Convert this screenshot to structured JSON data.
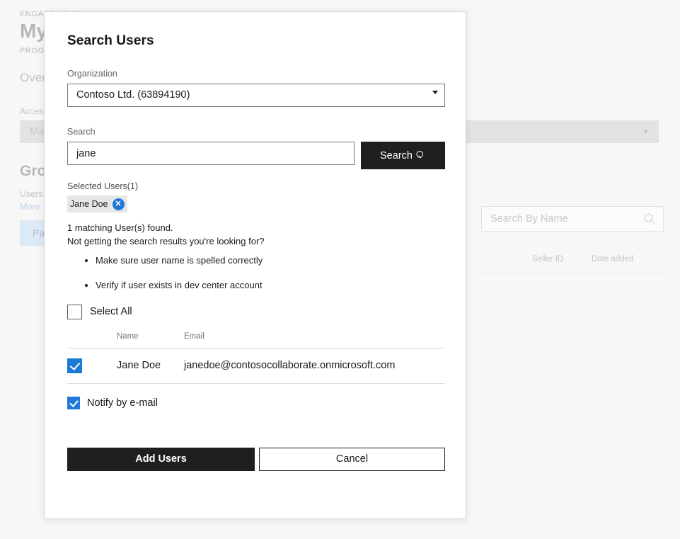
{
  "background": {
    "eyebrow": "ENGAGEMENT",
    "title": "My",
    "eyebrow2": "PROGRAM",
    "tab": "Overview",
    "access_label": "Access level",
    "access_value": "Manage",
    "section_title": "Groups",
    "paragraph": "Users below associ",
    "more_link": "More",
    "pill": "Partners",
    "search_placeholder": "Search By Name",
    "search_icon": "search-icon",
    "columns": [
      "Seller ID",
      "Date added"
    ],
    "caret_icon": "chevron-down-icon"
  },
  "modal": {
    "title": "Search Users",
    "organization": {
      "label": "Organization",
      "value": "Contoso Ltd. (63894190)",
      "caret_icon": "chevron-down-icon"
    },
    "search": {
      "label": "Search",
      "value": "jane",
      "placeholder": "",
      "button_label": "Search",
      "button_icon": "search-icon"
    },
    "selected_users": {
      "label": "Selected Users(1)",
      "chips": [
        {
          "name": "Jane Doe",
          "remove_icon": "close-circle-icon"
        }
      ]
    },
    "results": {
      "found_text": "1 matching User(s) found.",
      "prompt_text": "Not getting the search results you're looking for?",
      "tips": [
        "Make sure user name is spelled correctly",
        "Verify if user exists in dev center account"
      ]
    },
    "select_all": {
      "label": "Select All",
      "checked": false
    },
    "table": {
      "columns": [
        "Name",
        "Email"
      ],
      "rows": [
        {
          "checked": true,
          "name": "Jane Doe",
          "email": "janedoe@contosocollaborate.onmicrosoft.com"
        }
      ]
    },
    "notify": {
      "label": "Notify by e-mail",
      "checked": true
    },
    "footer": {
      "primary_label": "Add Users",
      "secondary_label": "Cancel"
    }
  },
  "colors": {
    "accent_blue": "#1e7ad6",
    "dark_button": "#1f1f1f",
    "pill_blue": "#dceaf7",
    "page_bg": "#f7f7f7"
  }
}
